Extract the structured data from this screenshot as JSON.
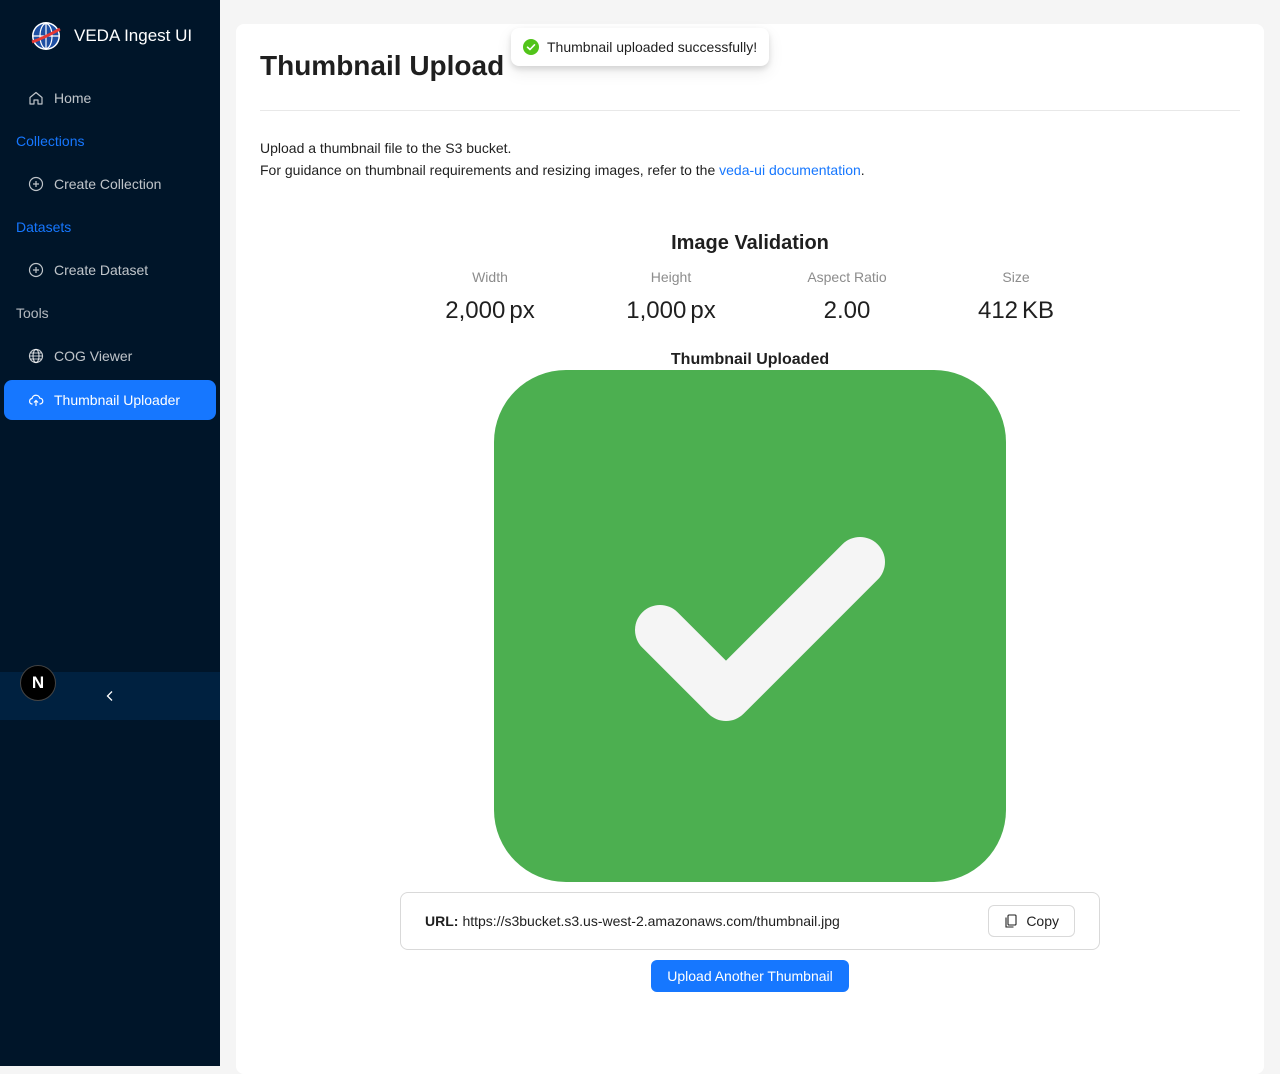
{
  "app": {
    "title": "VEDA Ingest UI",
    "brand_icon": "globe-logo-icon"
  },
  "sidebar": {
    "home": {
      "label": "Home",
      "icon": "home-icon"
    },
    "groups": {
      "collections": "Collections",
      "datasets": "Datasets",
      "tools": "Tools"
    },
    "create_collection": {
      "label": "Create Collection",
      "icon": "plus-circle-icon"
    },
    "create_dataset": {
      "label": "Create Dataset",
      "icon": "plus-circle-icon"
    },
    "cog_viewer": {
      "label": "COG Viewer",
      "icon": "globe-icon"
    },
    "thumbnail_uploader": {
      "label": "Thumbnail Uploader",
      "icon": "cloud-upload-icon",
      "active": true
    },
    "badge": "N",
    "collapse_icon": "chevron-left-icon"
  },
  "page": {
    "title": "Thumbnail Upload",
    "desc_line1": "Upload a thumbnail file to the S3 bucket.",
    "desc_line2_prefix": "For guidance on thumbnail requirements and resizing images, refer to the ",
    "desc_link": "veda-ui documentation",
    "desc_line2_suffix": "."
  },
  "validation": {
    "title": "Image Validation",
    "stats": [
      {
        "label": "Width",
        "value": "2,000",
        "unit": "px"
      },
      {
        "label": "Height",
        "value": "1,000",
        "unit": "px"
      },
      {
        "label": "Aspect Ratio",
        "value": "2.00",
        "unit": ""
      },
      {
        "label": "Size",
        "value": "412",
        "unit": "KB"
      }
    ]
  },
  "thumbnail": {
    "label": "Thumbnail Uploaded",
    "icon": "check-square-icon",
    "bg_color": "#4caf50",
    "check_color": "#f5f5f5"
  },
  "url": {
    "label": "URL:",
    "value": "https://s3bucket.s3.us-west-2.amazonaws.com/thumbnail.jpg",
    "copy_label": "Copy"
  },
  "actions": {
    "upload_another": "Upload Another Thumbnail"
  },
  "toast": {
    "message": "Thumbnail uploaded successfully!",
    "icon": "check-circle-icon"
  },
  "colors": {
    "primary": "#1677ff",
    "sidebar_bg": "#001529",
    "success": "#52c41a"
  }
}
